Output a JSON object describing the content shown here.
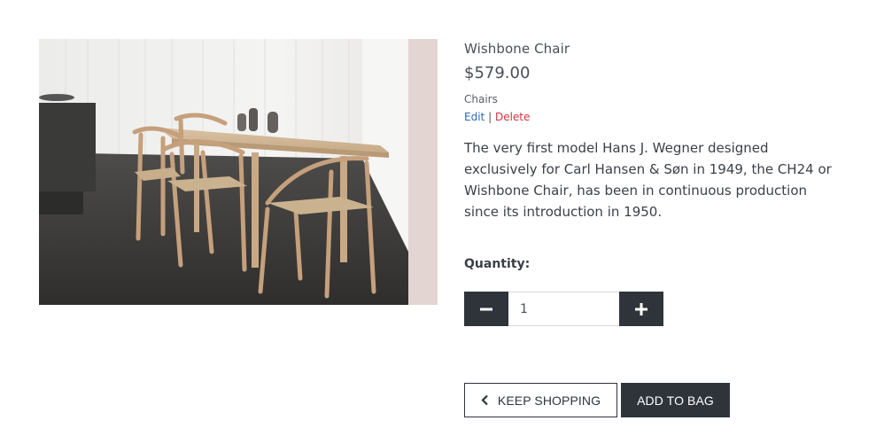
{
  "product": {
    "name": "Wishbone Chair",
    "price": "$579.00",
    "category": "Chairs",
    "description": "The very first model Hans J. Wegner designed exclusively for Carl Hansen & Søn in 1949, the CH24 or Wishbone Chair, has been in continuous production since its introduction in 1950.",
    "image_icon": "product-photo"
  },
  "admin": {
    "edit_label": "Edit",
    "separator": "|",
    "delete_label": "Delete"
  },
  "quantity": {
    "label": "Quantity:",
    "value": "1",
    "decrement_icon": "minus-icon",
    "increment_icon": "plus-icon"
  },
  "actions": {
    "keep_shopping_label": "KEEP SHOPPING",
    "add_to_bag_label": "ADD TO BAG"
  },
  "colors": {
    "dark": "#2f343b",
    "edit_link": "#2a6bb5",
    "delete_link": "#d0343c"
  }
}
